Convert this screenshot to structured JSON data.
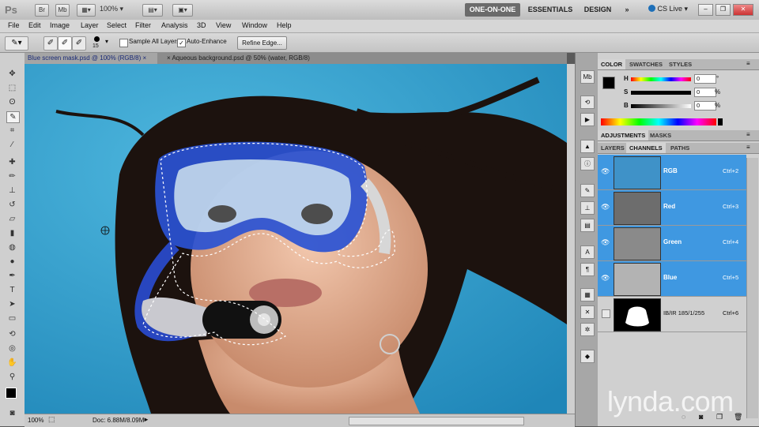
{
  "app": {
    "logo": "Ps",
    "bridge_btn": "Br",
    "minibridge_btn": "Mb",
    "zoom_level": "100%",
    "workspaces": [
      "ONE-ON-ONE",
      "ESSENTIALS",
      "DESIGN"
    ],
    "workspaces_more": "»",
    "cs_live": "CS Live"
  },
  "menu": [
    "File",
    "Edit",
    "Image",
    "Layer",
    "Select",
    "Filter",
    "Analysis",
    "3D",
    "View",
    "Window",
    "Help"
  ],
  "options": {
    "brush_size": "15",
    "sample_all_layers": "Sample All Layers",
    "auto_enhance": "Auto-Enhance",
    "refine_edge": "Refine Edge..."
  },
  "tabs": [
    {
      "label": "Blue screen mask.psd @ 100% (RGB/8)",
      "close": "×"
    },
    {
      "label": "Aqueous background.psd @ 50% (water, RGB/8)",
      "close": "×"
    }
  ],
  "status": {
    "zoom": "100%",
    "doc": "Doc: 6.88M/8.09M"
  },
  "color_panel": {
    "tabs": [
      "COLOR",
      "SWATCHES",
      "STYLES"
    ],
    "sliders": [
      {
        "label": "H",
        "value": "0",
        "unit": "°"
      },
      {
        "label": "S",
        "value": "0",
        "unit": "%"
      },
      {
        "label": "B",
        "value": "0",
        "unit": "%"
      }
    ]
  },
  "adjust_panel": {
    "tabs": [
      "ADJUSTMENTS",
      "MASKS"
    ]
  },
  "channels_panel": {
    "tabs": [
      "LAYERS",
      "CHANNELS",
      "PATHS"
    ],
    "channels": [
      {
        "name": "RGB",
        "key": "Ctrl+2",
        "selected": true,
        "visible": true
      },
      {
        "name": "Red",
        "key": "Ctrl+3",
        "selected": true,
        "visible": true
      },
      {
        "name": "Green",
        "key": "Ctrl+4",
        "selected": true,
        "visible": true
      },
      {
        "name": "Blue",
        "key": "Ctrl+5",
        "selected": true,
        "visible": true
      },
      {
        "name": "IB/IR 185/1/255",
        "key": "Ctrl+6",
        "selected": false,
        "visible": false
      }
    ]
  },
  "watermark": "lynda.com",
  "colors": {
    "accent": "#3f98e1",
    "canvas_bg": "#2d9fcf"
  }
}
